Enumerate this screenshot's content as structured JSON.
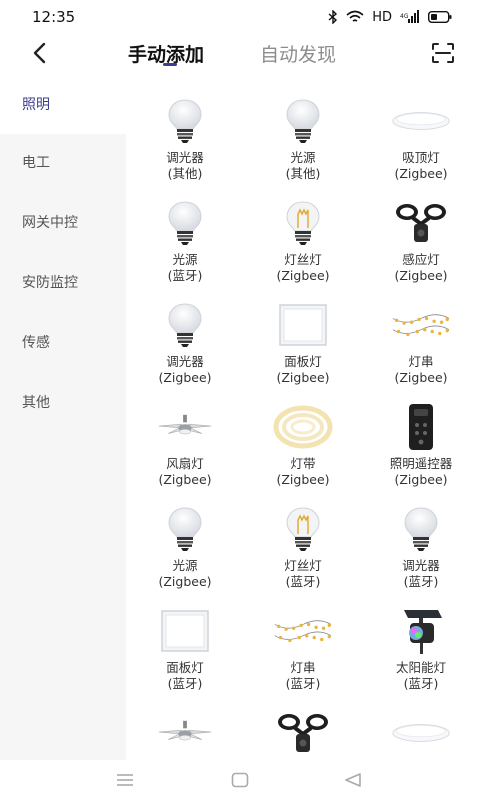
{
  "status": {
    "time": "12:35",
    "network_label": "HD"
  },
  "header": {
    "tabs": [
      {
        "label": "手动添加",
        "active": true
      },
      {
        "label": "自动发现",
        "active": false
      }
    ]
  },
  "sidebar": {
    "items": [
      {
        "label": "照明",
        "active": true
      },
      {
        "label": "电工",
        "active": false
      },
      {
        "label": "网关中控",
        "active": false
      },
      {
        "label": "安防监控",
        "active": false
      },
      {
        "label": "传感",
        "active": false
      },
      {
        "label": "其他",
        "active": false
      }
    ]
  },
  "devices": [
    {
      "name": "调光器",
      "protocol": "(其他)",
      "icon": "bulb-icon"
    },
    {
      "name": "光源",
      "protocol": "(其他)",
      "icon": "bulb-icon"
    },
    {
      "name": "吸顶灯",
      "protocol": "(Zigbee)",
      "icon": "ceiling-light-icon"
    },
    {
      "name": "光源",
      "protocol": "(蓝牙)",
      "icon": "bulb-icon"
    },
    {
      "name": "灯丝灯",
      "protocol": "(Zigbee)",
      "icon": "filament-bulb-icon"
    },
    {
      "name": "感应灯",
      "protocol": "(Zigbee)",
      "icon": "sensor-light-icon"
    },
    {
      "name": "调光器",
      "protocol": "(Zigbee)",
      "icon": "bulb-icon"
    },
    {
      "name": "面板灯",
      "protocol": "(Zigbee)",
      "icon": "panel-light-icon"
    },
    {
      "name": "灯串",
      "protocol": "(Zigbee)",
      "icon": "string-light-icon"
    },
    {
      "name": "风扇灯",
      "protocol": "(Zigbee)",
      "icon": "fan-light-icon"
    },
    {
      "name": "灯带",
      "protocol": "(Zigbee)",
      "icon": "light-strip-icon"
    },
    {
      "name": "照明遥控器",
      "protocol": "(Zigbee)",
      "icon": "remote-control-icon"
    },
    {
      "name": "光源",
      "protocol": "(Zigbee)",
      "icon": "bulb-icon"
    },
    {
      "name": "灯丝灯",
      "protocol": "(蓝牙)",
      "icon": "filament-bulb-icon"
    },
    {
      "name": "调光器",
      "protocol": "(蓝牙)",
      "icon": "bulb-icon"
    },
    {
      "name": "面板灯",
      "protocol": "(蓝牙)",
      "icon": "panel-light-icon"
    },
    {
      "name": "灯串",
      "protocol": "(蓝牙)",
      "icon": "string-light-icon"
    },
    {
      "name": "太阳能灯",
      "protocol": "(蓝牙)",
      "icon": "solar-light-icon"
    },
    {
      "name": "",
      "protocol": "",
      "icon": "fan-light-icon"
    },
    {
      "name": "",
      "protocol": "",
      "icon": "sensor-light-icon"
    },
    {
      "name": "",
      "protocol": "",
      "icon": "ceiling-light-icon"
    }
  ],
  "colors": {
    "accent": "#3c3f8e",
    "sidebar_bg": "#f6f6f6",
    "text_muted": "#8d8d8d"
  }
}
